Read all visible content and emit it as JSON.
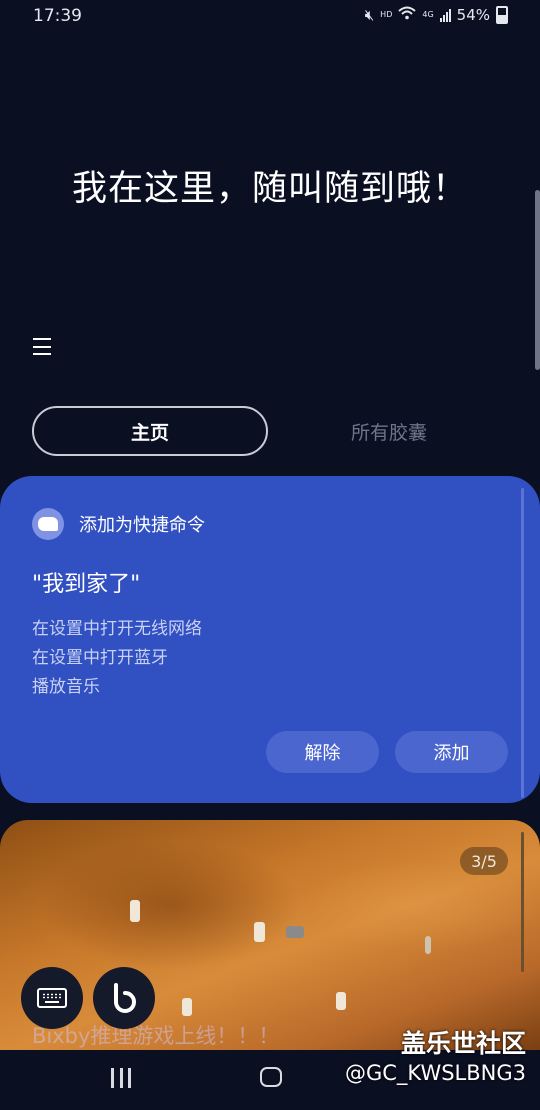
{
  "status_bar": {
    "time": "17:39",
    "hd_label": "HD",
    "network_label": "4G",
    "battery_percent": "54%",
    "icons": [
      "mute-icon",
      "wifi-icon",
      "signal-icon",
      "battery-icon"
    ]
  },
  "greeting": "我在这里，随叫随到哦！",
  "tabs": [
    {
      "label": "主页",
      "selected": true
    },
    {
      "label": "所有胶囊",
      "selected": false
    }
  ],
  "quick_command_card": {
    "header": "添加为快捷命令",
    "command": "\"我到家了\"",
    "actions": [
      "在设置中打开无线网络",
      "在设置中打开蓝牙",
      "播放音乐"
    ],
    "buttons": {
      "dismiss": "解除",
      "add": "添加"
    },
    "background_color": "#3150c2"
  },
  "image_card": {
    "page_indicator": "3/5",
    "title": "Bixby推理游戏上线！！！"
  },
  "watermark": {
    "site": "盖乐世社区",
    "user": "@GC_KWSLBNG3"
  }
}
